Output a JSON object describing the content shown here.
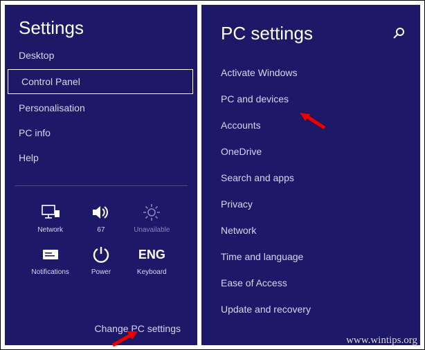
{
  "charm": {
    "title": "Settings",
    "items": [
      {
        "label": "Desktop",
        "selected": false
      },
      {
        "label": "Control Panel",
        "selected": true
      },
      {
        "label": "Personalisation",
        "selected": false
      },
      {
        "label": "PC info",
        "selected": false
      },
      {
        "label": "Help",
        "selected": false
      }
    ],
    "tiles": [
      {
        "name": "network-tile",
        "icon": "network-icon",
        "label": "Network"
      },
      {
        "name": "volume-tile",
        "icon": "volume-icon",
        "label": "67"
      },
      {
        "name": "brightness-tile",
        "icon": "brightness-icon",
        "label": "Unavailable"
      },
      {
        "name": "notifications-tile",
        "icon": "notifications-icon",
        "label": "Notifications"
      },
      {
        "name": "power-tile",
        "icon": "power-icon",
        "label": "Power"
      },
      {
        "name": "keyboard-tile",
        "icon": "keyboard-text",
        "text": "ENG",
        "label": "Keyboard"
      }
    ],
    "change_link": "Change PC settings"
  },
  "pcsettings": {
    "title": "PC settings",
    "items": [
      "Activate Windows",
      "PC and devices",
      "Accounts",
      "OneDrive",
      "Search and apps",
      "Privacy",
      "Network",
      "Time and language",
      "Ease of Access",
      "Update and recovery"
    ]
  },
  "watermark": "www.wintips.org"
}
